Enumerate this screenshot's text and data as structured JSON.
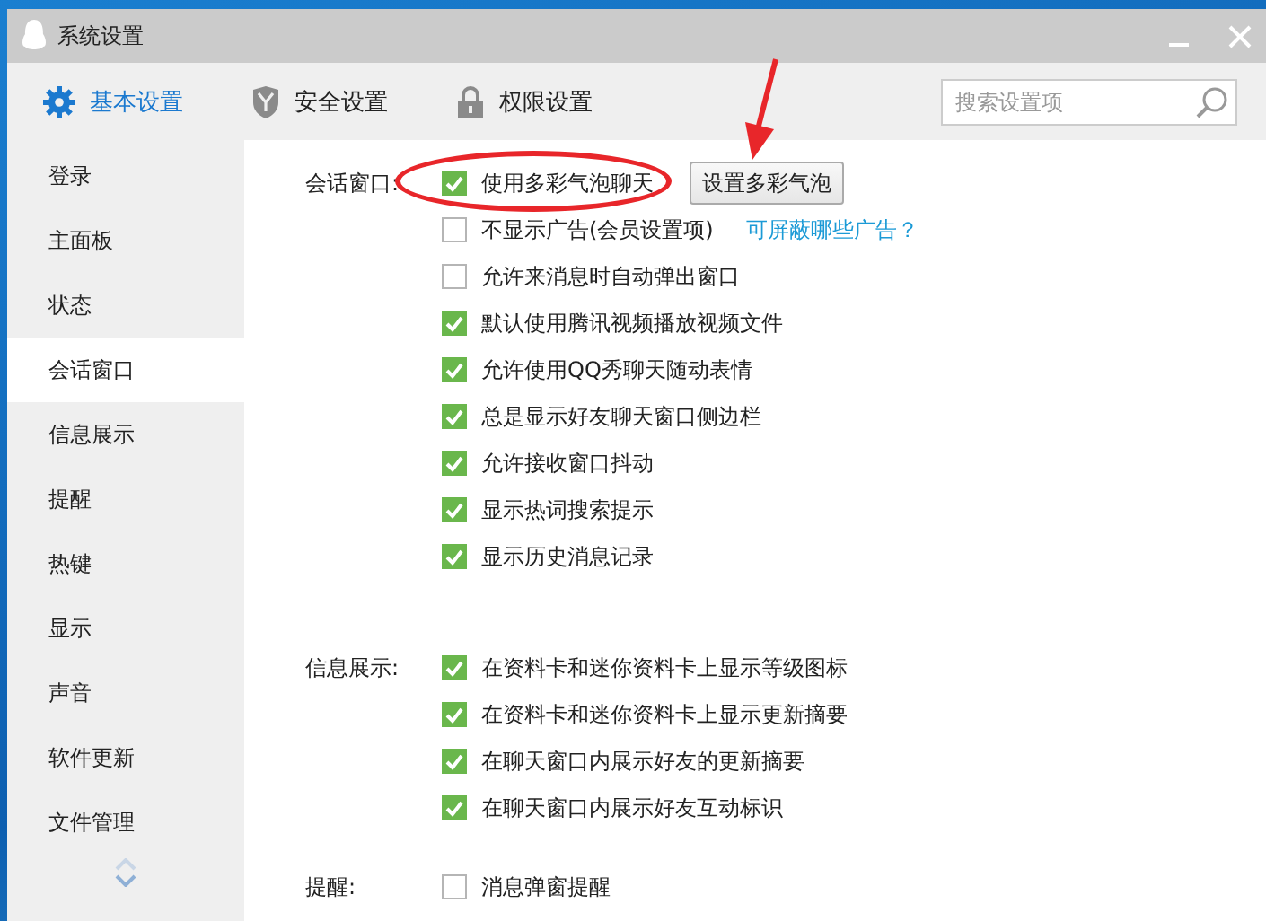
{
  "window": {
    "title": "系统设置"
  },
  "toolbar": {
    "tabs": [
      {
        "label": "基本设置",
        "selected": true,
        "kind": "gear"
      },
      {
        "label": "安全设置",
        "selected": false,
        "kind": "shield"
      },
      {
        "label": "权限设置",
        "selected": false,
        "kind": "lock"
      }
    ],
    "search": {
      "placeholder": "搜索设置项"
    }
  },
  "sidebar": {
    "items": [
      {
        "label": "登录",
        "selected": false
      },
      {
        "label": "主面板",
        "selected": false
      },
      {
        "label": "状态",
        "selected": false
      },
      {
        "label": "会话窗口",
        "selected": true
      },
      {
        "label": "信息展示",
        "selected": false
      },
      {
        "label": "提醒",
        "selected": false
      },
      {
        "label": "热键",
        "selected": false
      },
      {
        "label": "显示",
        "selected": false
      },
      {
        "label": "声音",
        "selected": false
      },
      {
        "label": "软件更新",
        "selected": false
      },
      {
        "label": "文件管理",
        "selected": false
      }
    ]
  },
  "sections": [
    {
      "label": "会话窗口:",
      "options": [
        {
          "label": "使用多彩气泡聊天",
          "checked": true,
          "circled": true,
          "button": "设置多彩气泡",
          "button_arrow": true
        },
        {
          "label": "不显示广告(会员设置项)",
          "checked": false,
          "link": "可屏蔽哪些广告？"
        },
        {
          "label": "允许来消息时自动弹出窗口",
          "checked": false
        },
        {
          "label": "默认使用腾讯视频播放视频文件",
          "checked": true
        },
        {
          "label": "允许使用QQ秀聊天随动表情",
          "checked": true
        },
        {
          "label": "总是显示好友聊天窗口侧边栏",
          "checked": true
        },
        {
          "label": "允许接收窗口抖动",
          "checked": true
        },
        {
          "label": "显示热词搜索提示",
          "checked": true
        },
        {
          "label": "显示历史消息记录",
          "checked": true
        }
      ]
    },
    {
      "label": "信息展示:",
      "options": [
        {
          "label": "在资料卡和迷你资料卡上显示等级图标",
          "checked": true
        },
        {
          "label": "在资料卡和迷你资料卡上显示更新摘要",
          "checked": true
        },
        {
          "label": "在聊天窗口内展示好友的更新摘要",
          "checked": true
        },
        {
          "label": "在聊天窗口内展示好友互动标识",
          "checked": true
        }
      ]
    },
    {
      "label": "提醒:",
      "options": [
        {
          "label": "消息弹窗提醒",
          "checked": false
        }
      ]
    }
  ]
}
